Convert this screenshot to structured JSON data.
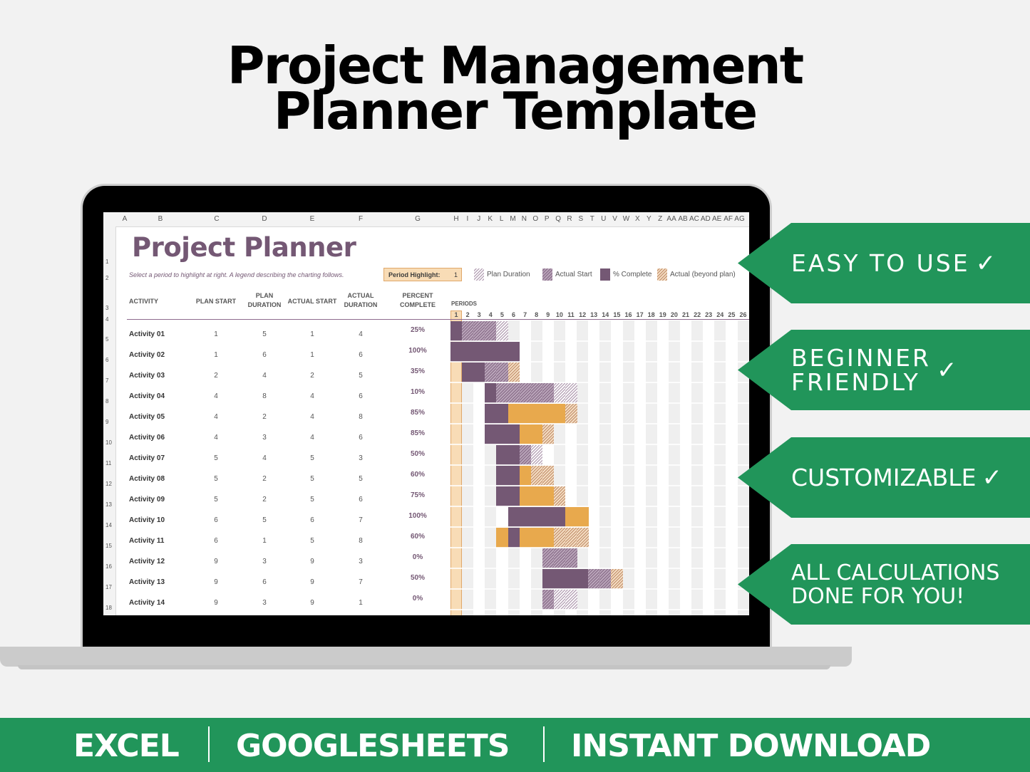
{
  "headline": {
    "line1": "Project Management",
    "line2": "Planner Template"
  },
  "spreadsheet": {
    "column_letters": [
      "A",
      "B",
      "C",
      "D",
      "E",
      "F",
      "G",
      "H",
      "I",
      "J",
      "K",
      "L",
      "M",
      "N",
      "O",
      "P",
      "Q",
      "R",
      "S",
      "T",
      "U",
      "V",
      "W",
      "X",
      "Y",
      "Z",
      "AA",
      "AB",
      "AC",
      "AD",
      "AE",
      "AF",
      "AG"
    ],
    "row_numbers": [
      "1",
      "2",
      "3",
      "4",
      "5",
      "6",
      "7",
      "8",
      "9",
      "10",
      "11",
      "12",
      "13",
      "14",
      "15",
      "16",
      "17",
      "18"
    ],
    "title": "Project Planner",
    "subtitle": "Select a period to highlight at right.  A legend describing the charting follows.",
    "period_highlight": {
      "label": "Period Highlight:",
      "value": "1"
    },
    "legend": [
      {
        "label": "Plan Duration",
        "kind": "plan"
      },
      {
        "label": "Actual Start",
        "kind": "actual"
      },
      {
        "label": "% Complete",
        "kind": "complete"
      },
      {
        "label": "Actual (beyond plan)",
        "kind": "beyond"
      }
    ],
    "headers": {
      "activity": "ACTIVITY",
      "plan_start": "PLAN START",
      "plan_duration_1": "PLAN",
      "plan_duration_2": "DURATION",
      "actual_start": "ACTUAL START",
      "actual_duration_1": "ACTUAL",
      "actual_duration_2": "DURATION",
      "percent_1": "PERCENT",
      "percent_2": "COMPLETE",
      "periods": "PERIODS"
    },
    "colors": {
      "purple": "#745874",
      "orange": "#e8a94d",
      "highlight": "#f8dcb6",
      "green": "#21955a"
    }
  },
  "chart_data": {
    "type": "gantt",
    "title": "Project Planner",
    "periods": [
      1,
      2,
      3,
      4,
      5,
      6,
      7,
      8,
      9,
      10,
      11,
      12,
      13,
      14,
      15,
      16,
      17,
      18,
      19,
      20,
      21,
      22,
      23,
      24,
      25,
      26
    ],
    "highlighted_period": 1,
    "activities": [
      {
        "name": "Activity 01",
        "plan_start": 1,
        "plan_duration": 5,
        "actual_start": 1,
        "actual_duration": 4,
        "percent_complete": "25%"
      },
      {
        "name": "Activity 02",
        "plan_start": 1,
        "plan_duration": 6,
        "actual_start": 1,
        "actual_duration": 6,
        "percent_complete": "100%"
      },
      {
        "name": "Activity 03",
        "plan_start": 2,
        "plan_duration": 4,
        "actual_start": 2,
        "actual_duration": 5,
        "percent_complete": "35%"
      },
      {
        "name": "Activity 04",
        "plan_start": 4,
        "plan_duration": 8,
        "actual_start": 4,
        "actual_duration": 6,
        "percent_complete": "10%"
      },
      {
        "name": "Activity 05",
        "plan_start": 4,
        "plan_duration": 2,
        "actual_start": 4,
        "actual_duration": 8,
        "percent_complete": "85%"
      },
      {
        "name": "Activity 06",
        "plan_start": 4,
        "plan_duration": 3,
        "actual_start": 4,
        "actual_duration": 6,
        "percent_complete": "85%"
      },
      {
        "name": "Activity 07",
        "plan_start": 5,
        "plan_duration": 4,
        "actual_start": 5,
        "actual_duration": 3,
        "percent_complete": "50%"
      },
      {
        "name": "Activity 08",
        "plan_start": 5,
        "plan_duration": 2,
        "actual_start": 5,
        "actual_duration": 5,
        "percent_complete": "60%"
      },
      {
        "name": "Activity 09",
        "plan_start": 5,
        "plan_duration": 2,
        "actual_start": 5,
        "actual_duration": 6,
        "percent_complete": "75%"
      },
      {
        "name": "Activity 10",
        "plan_start": 6,
        "plan_duration": 5,
        "actual_start": 6,
        "actual_duration": 7,
        "percent_complete": "100%"
      },
      {
        "name": "Activity 11",
        "plan_start": 6,
        "plan_duration": 1,
        "actual_start": 5,
        "actual_duration": 8,
        "percent_complete": "60%"
      },
      {
        "name": "Activity 12",
        "plan_start": 9,
        "plan_duration": 3,
        "actual_start": 9,
        "actual_duration": 3,
        "percent_complete": "0%"
      },
      {
        "name": "Activity 13",
        "plan_start": 9,
        "plan_duration": 6,
        "actual_start": 9,
        "actual_duration": 7,
        "percent_complete": "50%"
      },
      {
        "name": "Activity 14",
        "plan_start": 9,
        "plan_duration": 3,
        "actual_start": 9,
        "actual_duration": 1,
        "percent_complete": "0%"
      }
    ]
  },
  "features": [
    {
      "text": "EASY TO USE",
      "check": "✓"
    },
    {
      "text": "BEGINNER\nFRIENDLY",
      "check": "✓"
    },
    {
      "text": "CUSTOMIZABLE",
      "check": "✓"
    },
    {
      "text": "ALL CALCULATIONS\nDONE FOR YOU!",
      "check": ""
    }
  ],
  "footer": {
    "item1": "EXCEL",
    "item2": "GOOGLESHEETS",
    "item3": "INSTANT DOWNLOAD"
  }
}
